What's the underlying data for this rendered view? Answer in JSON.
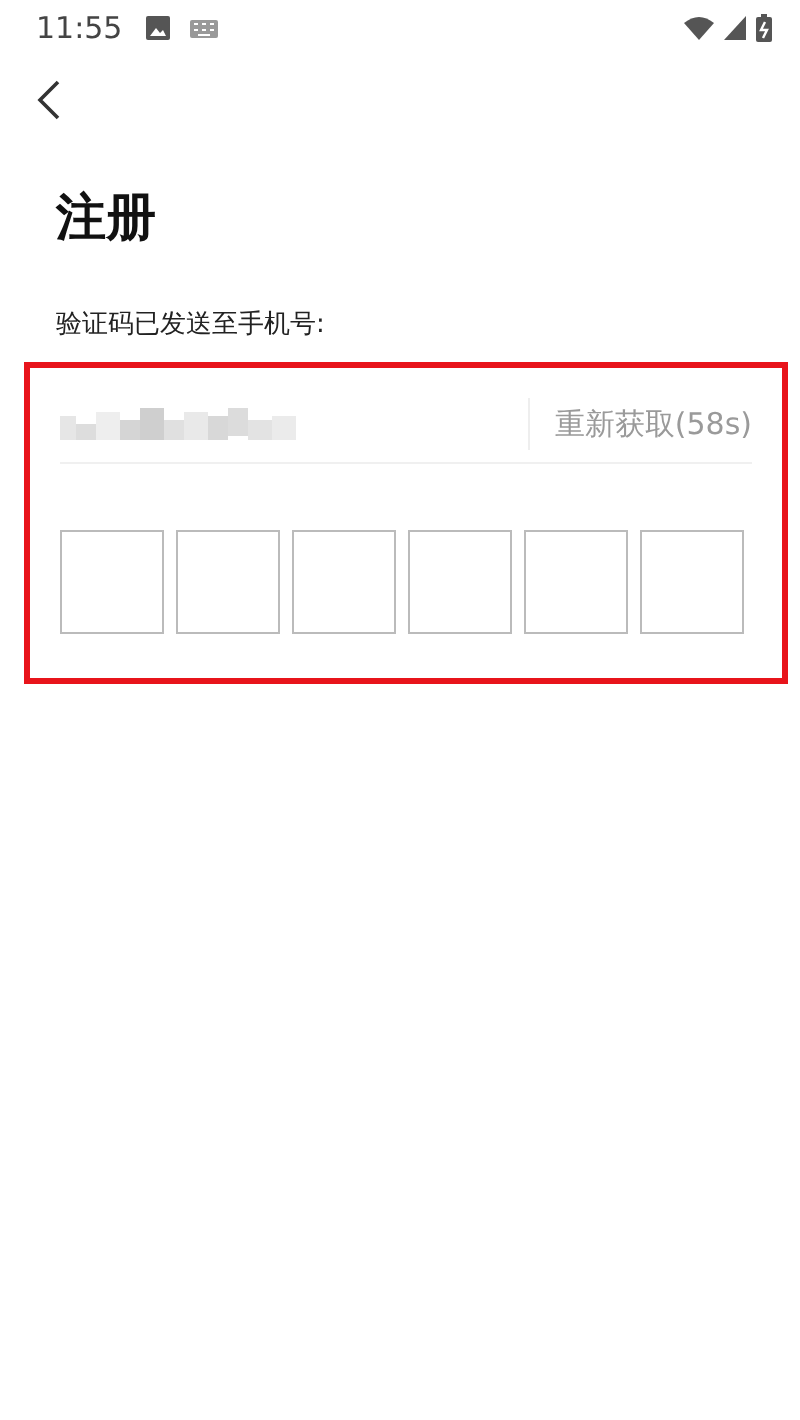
{
  "status_bar": {
    "time": "11:55"
  },
  "title": "注册",
  "sent_label": "验证码已发送至手机号:",
  "phone_number": {
    "kind": "redacted"
  },
  "resend": {
    "label": "重新获取(58s)",
    "disabled": true
  },
  "code_boxes": [
    {
      "filled": false
    },
    {
      "filled": false
    },
    {
      "filled": false
    },
    {
      "filled": false
    },
    {
      "filled": false
    },
    {
      "filled": false
    }
  ],
  "highlight": {
    "color": "#e8141b"
  }
}
